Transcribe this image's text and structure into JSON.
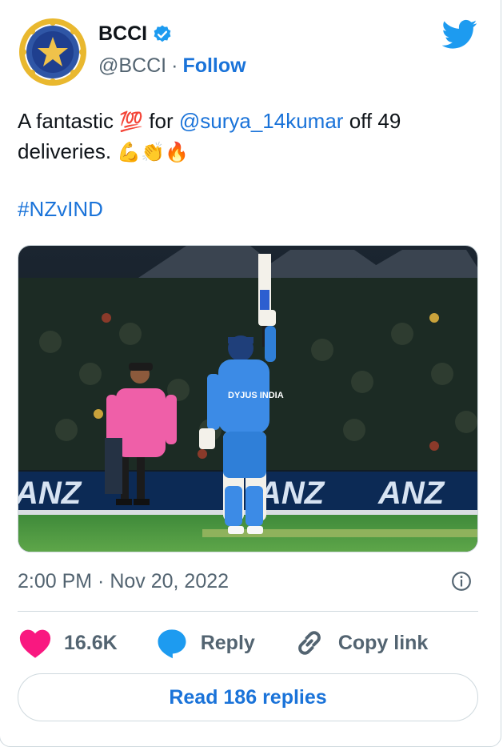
{
  "author": {
    "name": "BCCI",
    "handle": "@BCCI",
    "separator": "·",
    "follow_label": "Follow"
  },
  "tweet": {
    "text_prefix": "A fantastic ",
    "emoji_100": "💯",
    "text_for": " for ",
    "mention": "@surya_14kumar",
    "text_suffix": " off 49 deliveries. ",
    "emoji_tail": "💪👏🔥",
    "hashtag": "#NZvIND"
  },
  "media": {
    "icon": "cricket-photo",
    "jersey_text": "DYJUS INDIA",
    "banner_text": "ANZ"
  },
  "meta": {
    "timestamp": "2:00 PM · Nov 20, 2022"
  },
  "actions": {
    "likes": "16.6K",
    "reply_label": "Reply",
    "copy_label": "Copy link"
  },
  "read_replies_label": "Read 186 replies",
  "colors": {
    "accent": "#1a73d9",
    "twitter_blue": "#1d9bf0",
    "like_pink": "#f91880",
    "muted": "#536471"
  }
}
